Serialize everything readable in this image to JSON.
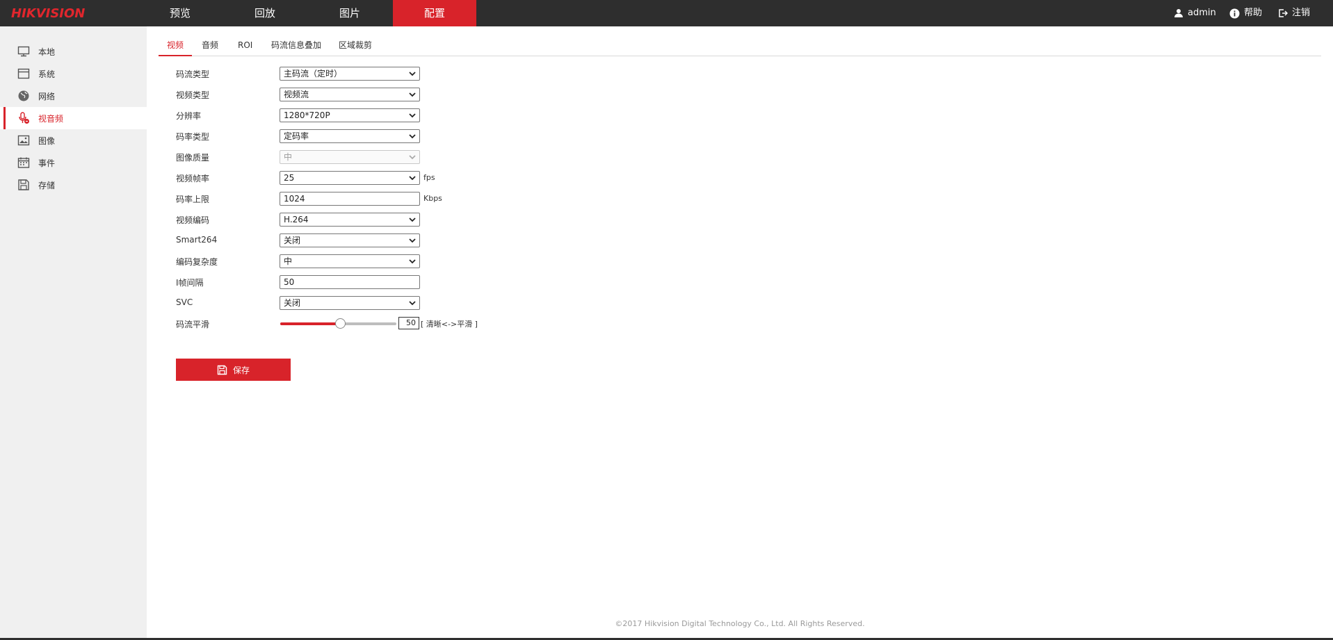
{
  "header": {
    "logo": "HIKVISION",
    "nav": [
      "预览",
      "回放",
      "图片",
      "配置"
    ],
    "active_nav": "配置",
    "user": "admin",
    "help": "帮助",
    "logout": "注销"
  },
  "sidebar": {
    "items": [
      {
        "label": "本地",
        "icon": "monitor-icon"
      },
      {
        "label": "系统",
        "icon": "system-icon"
      },
      {
        "label": "网络",
        "icon": "globe-icon"
      },
      {
        "label": "视音频",
        "icon": "microphone-icon"
      },
      {
        "label": "图像",
        "icon": "image-icon"
      },
      {
        "label": "事件",
        "icon": "calendar-icon"
      },
      {
        "label": "存储",
        "icon": "save-icon"
      }
    ],
    "active": "视音频"
  },
  "tabs": [
    "视频",
    "音频",
    "ROI",
    "码流信息叠加",
    "区域裁剪"
  ],
  "active_tab": "视频",
  "form": {
    "stream_type": {
      "label": "码流类型",
      "value": "主码流（定时）"
    },
    "video_type": {
      "label": "视频类型",
      "value": "视频流"
    },
    "resolution": {
      "label": "分辨率",
      "value": "1280*720P"
    },
    "bitrate_type": {
      "label": "码率类型",
      "value": "定码率"
    },
    "image_quality": {
      "label": "图像质量",
      "value": "中"
    },
    "frame_rate": {
      "label": "视频帧率",
      "value": "25",
      "unit": "fps"
    },
    "bitrate_max": {
      "label": "码率上限",
      "value": "1024",
      "unit": "Kbps"
    },
    "video_encoding": {
      "label": "视频编码",
      "value": "H.264"
    },
    "smart264": {
      "label": "Smart264",
      "value": "关闭"
    },
    "encoding_complexity": {
      "label": "编码复杂度",
      "value": "中"
    },
    "i_frame_interval": {
      "label": "I帧间隔",
      "value": "50"
    },
    "svc": {
      "label": "SVC",
      "value": "关闭"
    },
    "stream_smoothing": {
      "label": "码流平滑",
      "value": "50",
      "level": 0.5,
      "hint": "[ 清晰<->平滑 ]"
    }
  },
  "save_label": "保存",
  "footer": "©2017 Hikvision Digital Technology Co., Ltd. All Rights Reserved.",
  "colors": {
    "accent": "#d8232a",
    "topbar": "#2e2e2e",
    "sidebar": "#f0f0f0"
  }
}
